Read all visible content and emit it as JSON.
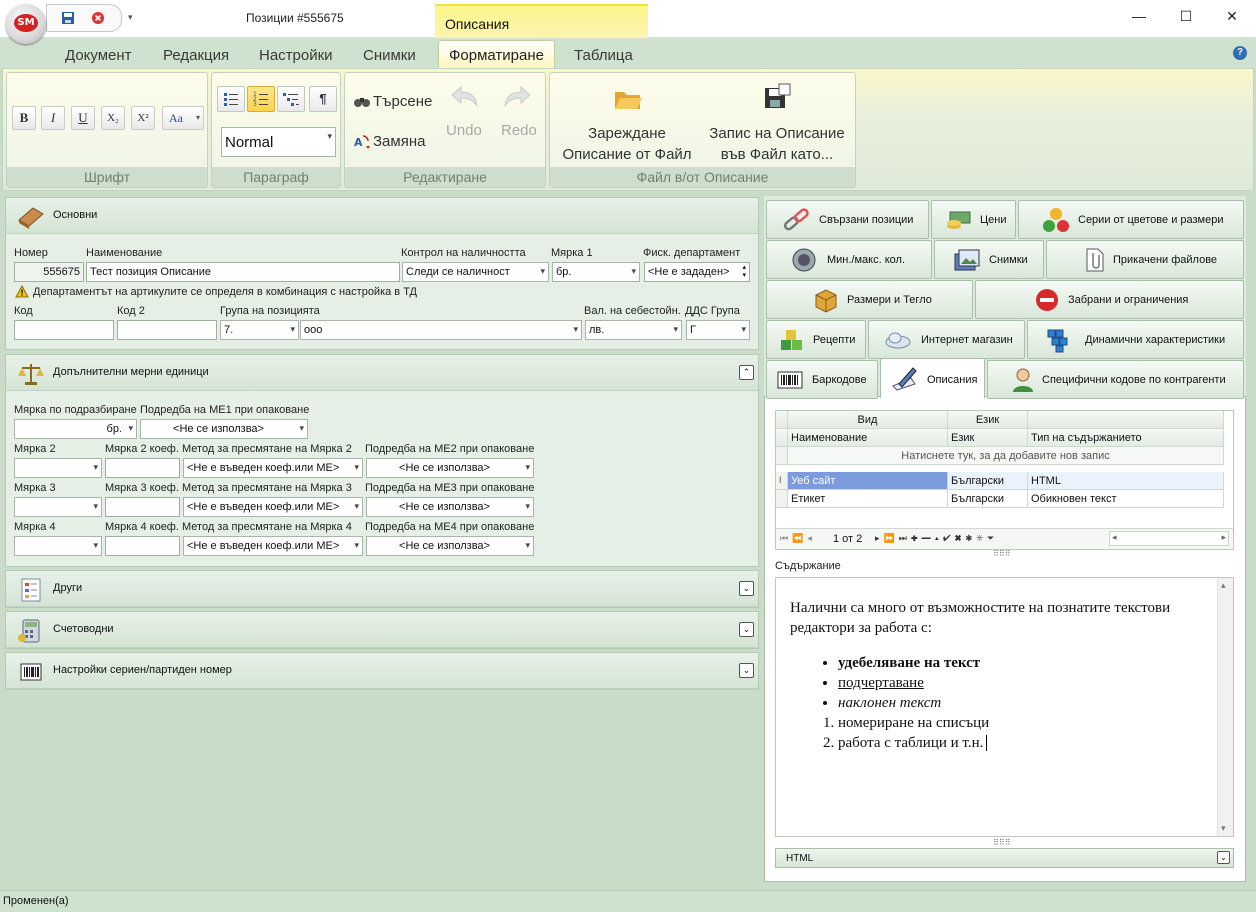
{
  "window": {
    "title": "Позиции #555675",
    "context_tab": "Описания"
  },
  "ribbon": {
    "tabs": [
      "Документ",
      "Редакция",
      "Настройки",
      "Снимки",
      "Форматиране",
      "Таблица"
    ],
    "font_group": {
      "title": "Шрифт",
      "bold": "B",
      "italic": "I",
      "underline": "U",
      "subscript": "X₂",
      "superscript": "X²",
      "case": "Aa"
    },
    "paragraph_group": {
      "title": "Параграф",
      "style_value": "Normal",
      "pilcrow": "¶"
    },
    "edit_group": {
      "title": "Редактиране",
      "find": "Търсене",
      "replace": "Замяна",
      "undo": "Undo",
      "redo": "Redo"
    },
    "file_group": {
      "title": "Файл в/от Описание",
      "load_line1": "Зареждане",
      "load_line2": "Описание от Файл",
      "save_line1": "Запис на Описание",
      "save_line2": "във Файл като..."
    }
  },
  "basic": {
    "title": "Основни",
    "number_label": "Номер",
    "number_value": "555675",
    "name_label": "Наименование",
    "name_value": "Тест позиция Описание",
    "stock_label": "Контрол на наличността",
    "stock_value": "Следи се наличност",
    "unit_label": "Мярка 1",
    "unit_value": "бр.",
    "fiscal_label": "Фиск. департамент",
    "fiscal_value": "<Не е зададен>",
    "warning": "Департаментът на артикулите се определя в комбинация с настройка в ТД",
    "code_label": "Код",
    "code2_label": "Код 2",
    "group_label": "Група на позицията",
    "group_code": "7.",
    "group_name": "ооо",
    "currency_label": "Вал. на себестойн.",
    "currency_value": "лв.",
    "vat_label": "ДДС Група",
    "vat_value": "Г"
  },
  "units": {
    "title": "Допълнителни мерни единици",
    "default_label": "Мярка по подразбиране",
    "default_value": "бр.",
    "order1_label": "Подредба на МЕ1 при опаковане",
    "order1_value": "<Не се използва>",
    "rows": [
      {
        "unit_label": "Мярка 2",
        "coef_label": "Мярка 2 коеф.",
        "method_label": "Метод за пресмятане на Мярка 2",
        "method_value": "<Не е въведен коеф.или МЕ>",
        "order_label": "Подредба на МЕ2 при опаковане",
        "order_value": "<Не се използва>"
      },
      {
        "unit_label": "Мярка 3",
        "coef_label": "Мярка 3 коеф.",
        "method_label": "Метод за пресмятане на Мярка 3",
        "method_value": "<Не е въведен коеф.или МЕ>",
        "order_label": "Подредба на МЕ3 при опаковане",
        "order_value": "<Не се използва>"
      },
      {
        "unit_label": "Мярка 4",
        "coef_label": "Мярка 4 коеф.",
        "method_label": "Метод за пресмятане на Мярка 4",
        "method_value": "<Не е въведен коеф.или МЕ>",
        "order_label": "Подредба на МЕ4 при опаковане",
        "order_value": "<Не се използва>"
      }
    ]
  },
  "collapsed_sections": [
    "Други",
    "Счетоводни",
    "Настройки сериен/партиден номер"
  ],
  "right_tabs": {
    "row1": [
      "Свързани позиции",
      "Цени",
      "Серии от цветове и размери"
    ],
    "row2": [
      "Мин./макс. кол.",
      "Снимки",
      "Прикачени файлове"
    ],
    "row3": [
      "Размери и Тегло",
      "Забрани и ограничения"
    ],
    "row4": [
      "Рецепти",
      "Интернет магазин",
      "Динамични характеристики"
    ],
    "row5": [
      "Баркодове",
      "Описания",
      "Специфични кодове по контрагенти"
    ]
  },
  "grid": {
    "group_headers": [
      "Вид",
      "Език"
    ],
    "columns": [
      "Наименование",
      "Език",
      "Тип на съдържанието"
    ],
    "new_row_hint": "Натиснете тук, за да добавите нов запис",
    "rows": [
      [
        "Уеб сайт",
        "Български",
        "HTML"
      ],
      [
        "Етикет",
        "Български",
        "Обикновен текст"
      ]
    ],
    "pager": "1 от 2"
  },
  "content": {
    "label": "Съдържание",
    "intro": "Налични са много от възможностите на познатите текстови редактори за работа с:",
    "bullets": [
      "удебеляване на текст",
      "подчертаване",
      "наклонен текст"
    ],
    "numbered": [
      "номериране на списъци",
      "работа с таблици и т.н."
    ],
    "format_value": "HTML"
  },
  "status": {
    "text": "Променен(а)"
  }
}
